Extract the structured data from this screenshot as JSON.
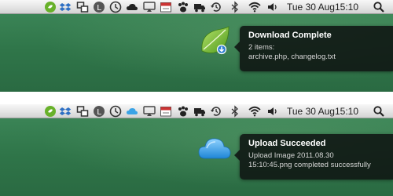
{
  "menubar": {
    "date": "Tue 30 Aug",
    "time": "15:10",
    "icons": [
      "evernote-icon",
      "dropbox-icon",
      "screen-sharing-icon",
      "growl-icon",
      "time-icon",
      "cloud-icon",
      "airplay-icon",
      "calendar-icon",
      "paw-icon",
      "truck-icon",
      "time-machine-icon",
      "bluetooth-icon",
      "wifi-icon",
      "volume-icon",
      "spotlight-icon"
    ]
  },
  "notifications": [
    {
      "title": "Download Complete",
      "line1": "2 items:",
      "line2": "archive.php, changelog.txt",
      "icon": "leaf-download-icon",
      "accent": "#7bbf3a"
    },
    {
      "title": "Upload Succeeded",
      "line1": "Upload Image 2011.08.30",
      "line2": "15:10:45.png completed successfully",
      "icon": "cloud-upload-icon",
      "accent": "#3aa3e6"
    }
  ],
  "colors": {
    "desktop": "#2f7549",
    "menubar": "#e4e4e4",
    "notification_bg": "#0f1412"
  }
}
